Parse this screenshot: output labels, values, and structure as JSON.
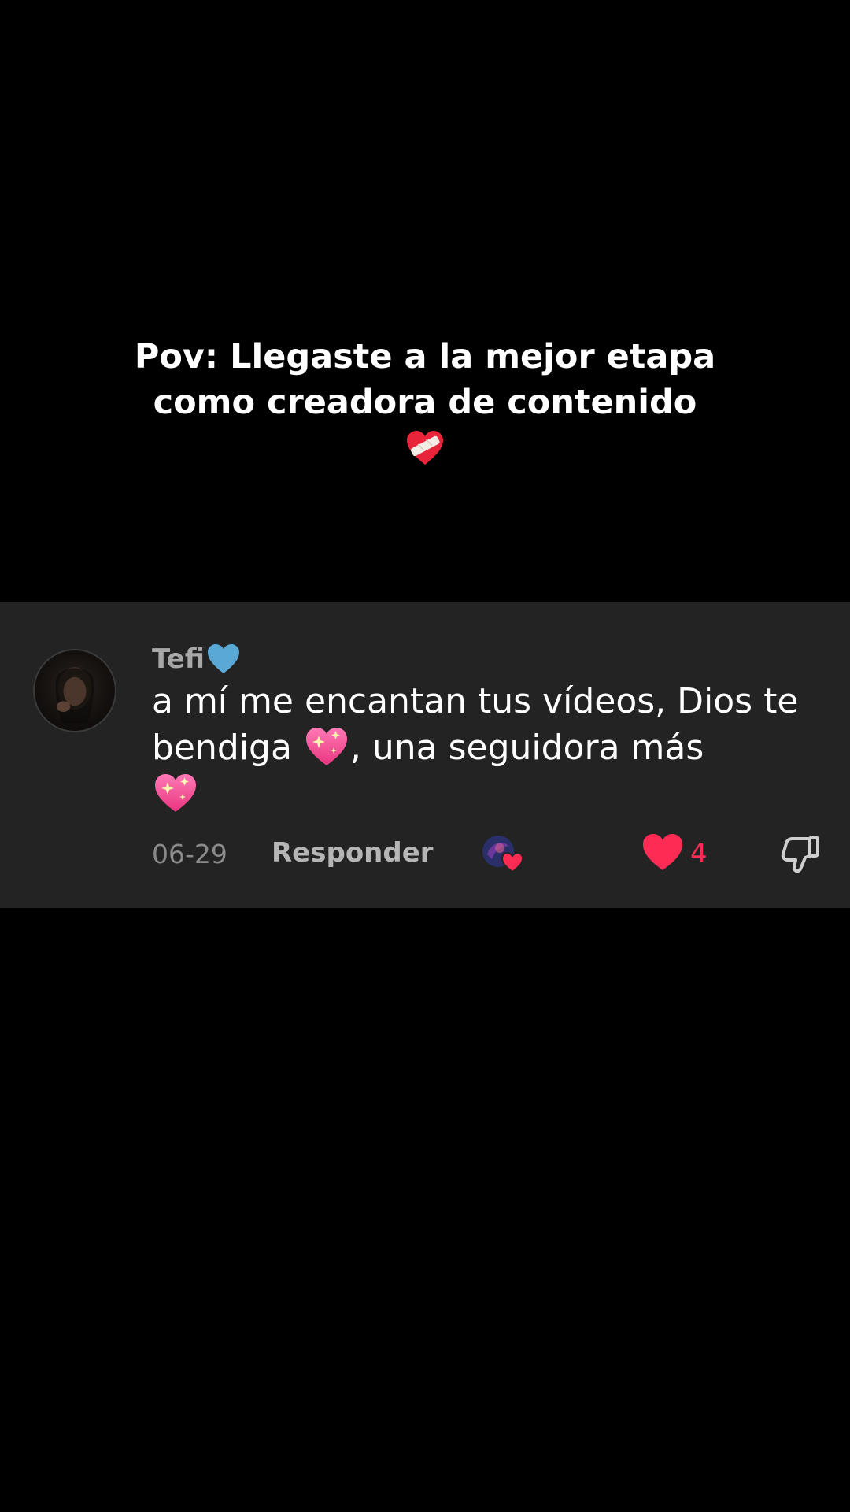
{
  "caption": {
    "line1": "Pov: Llegaste a la mejor etapa",
    "line2": "como creadora de contenido",
    "emoji_icon": "mending-heart-icon"
  },
  "comment": {
    "username": "Tefi",
    "username_emoji_icon": "blue-heart-icon",
    "text_part1": "a mí me encantan tus vídeos, Dios te bendiga ",
    "text_part2": ", una seguidora más",
    "text_emoji_icon": "sparkling-heart-icon",
    "date": "06-29",
    "reply_label": "Responder",
    "like_count": "4",
    "liked": true
  },
  "colors": {
    "background": "#000000",
    "card": "#232323",
    "like_red": "#fe2c55",
    "muted_text": "#8a8a8a"
  }
}
